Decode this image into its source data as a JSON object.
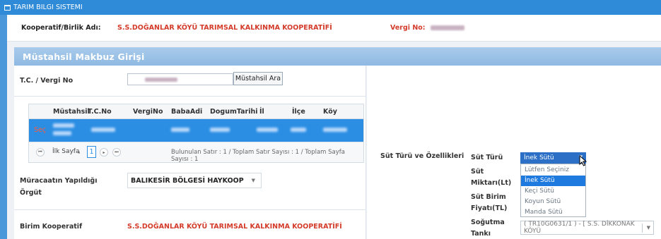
{
  "window": {
    "title": "TARIM BILGI SISTEMI"
  },
  "info": {
    "coop_label": "Kooperatif/Birlik Adı:",
    "coop_name": "S.S.DOĞANLAR KÖYÜ TARIMSAL KALKINMA KOOPERATİFİ",
    "vergi_label": "Vergi No:"
  },
  "section": {
    "title": "Müstahsil Makbuz Girişi"
  },
  "form": {
    "tc_label": "T.C. / Vergi No",
    "search_button": "Müstahsil Ara",
    "org_label": "Müracaatın Yapıldığı Örgüt",
    "org_value": "BALIKESİR BÖLGESİ HAYKOOP",
    "birim_label": "Birim Kooperatif",
    "birim_value": "S.S.DOĞANLAR KÖYÜ TARIMSAL KALKINMA KOOPERATİFİ"
  },
  "grid": {
    "columns": [
      "Müstahsil",
      "T.C.No",
      "VergiNo",
      "BabaAdi",
      "DogumTarihi",
      "İl",
      "İlçe",
      "Köy"
    ],
    "row_action": "Seç",
    "pager": {
      "first_page": "İlk Sayfa",
      "current_page": "1",
      "status": "Bulunulan Satır : 1 / Toplam Satır Sayısı : 1 / Toplam Sayfa Sayısı : 1"
    }
  },
  "right": {
    "section_label": "Süt Türü ve Özellikleri",
    "sut_turu_label": "Süt Türü",
    "sut_miktari_label": "Süt Miktarı(Lt)",
    "sut_birim_label": "Süt Birim Fiyatı(TL)",
    "sogutma_label": "Soğutma Tankı",
    "sut_turu_selected": "İnek Sütü",
    "sut_turu_options": [
      "Lütfen Seçiniz",
      "İnek Sütü",
      "Keçi Sütü",
      "Koyun Sütü",
      "Manda Sütü"
    ],
    "tank_value": "( TR10G0631/1 ) - [ S.S. DİKKONAK KÖYÜ"
  },
  "colors": {
    "titlebar": "#2f8bd8",
    "section_header": "#9fc4e8",
    "selected_row": "#2b8ee3",
    "red_text": "#d33b2a",
    "dropdown_selected": "#1f7ae0"
  }
}
